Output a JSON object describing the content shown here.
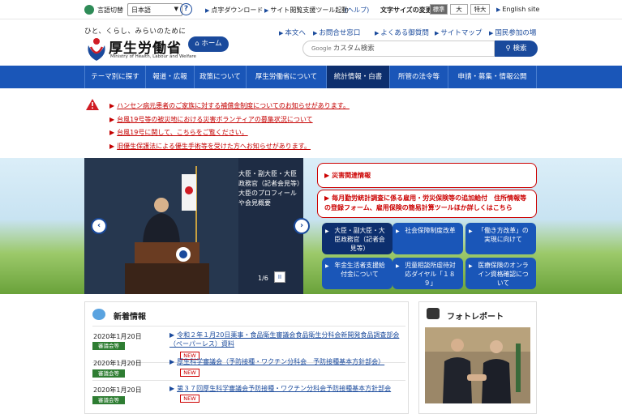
{
  "util": {
    "lang_label": "言語切替",
    "lang_value": "日本語",
    "help_glyph": "?",
    "dot_download": "点字ダウンロード",
    "reader_tool": "サイト閲覧支援ツール起動",
    "help_link": "(ヘルプ)",
    "textsize_label": "文字サイズの変更",
    "size_standard": "標準",
    "size_large": "大",
    "size_xlarge": "特大",
    "english": "English site"
  },
  "header": {
    "tagline": "ひと、くらし、みらいのために",
    "logo_text": "厚生労働省",
    "logo_sub": "Ministry of Health, Labour and Welfare",
    "home": "ホーム",
    "links": [
      "本文へ",
      "お問合せ窓口",
      "よくある御質問",
      "サイトマップ",
      "国民参加の場"
    ],
    "search_brand": "Google",
    "search_placeholder": "カスタム検索",
    "search_button": "検索"
  },
  "nav": [
    "テーマ別に探す",
    "報道・広報",
    "政策について",
    "厚生労働省について",
    "統計情報・白書",
    "所管の法令等",
    "申請・募集・情報公開"
  ],
  "alerts": [
    "ハンセン病元患者のご家族に対する補償金制度についてのお知らせがあります。",
    "台風19号等の被災地における災害ボランティアの募集状況について",
    "台風19号に関して、こちらをご覧ください。",
    "旧優生保護法による優生手術等を受けた方へお知らせがあります。"
  ],
  "hero": {
    "caption": "大臣・副大臣・大臣政務官（記者会見等）大臣のプロフィールや会見概要",
    "pager": "1/6",
    "pause": "II",
    "prev": "‹",
    "next": "›",
    "disaster": "災害関連情報",
    "notice": "毎月勤労統計調査に係る雇用・労災保険等の追加給付　住所情報等の登録フォーム、雇用保険の簡易計算ツールほか詳しくはこちら",
    "tiles": [
      "大臣・副大臣・大臣政務官（記者会見等）",
      "社会保障制度改革",
      "「働き方改革」の実現に向けて",
      "年金生活者支援給付金について",
      "児童相談所虐待対応ダイヤル「１８９」",
      "医療保険のオンライン資格確認について"
    ]
  },
  "news": {
    "heading": "新着情報",
    "items": [
      {
        "date": "2020年1月20日",
        "badge": "審議会等",
        "text": "令和２年１月20日薬事・食品衛生審議会食品衛生分科会新開発食品調査部会（ペーパーレス）資料",
        "new": "NEW"
      },
      {
        "date": "2020年1月20日",
        "badge": "審議会等",
        "text": "厚生科学審議会（予防接種・ワクチン分科会　予防接種基本方針部会）",
        "new": "NEW"
      },
      {
        "date": "2020年1月20日",
        "badge": "審議会等",
        "text": "第３７回厚生科学審議会予防接種・ワクチン分科会予防接種基本方針部会",
        "new": "NEW"
      }
    ]
  },
  "photo": {
    "heading": "フォトレポート"
  }
}
